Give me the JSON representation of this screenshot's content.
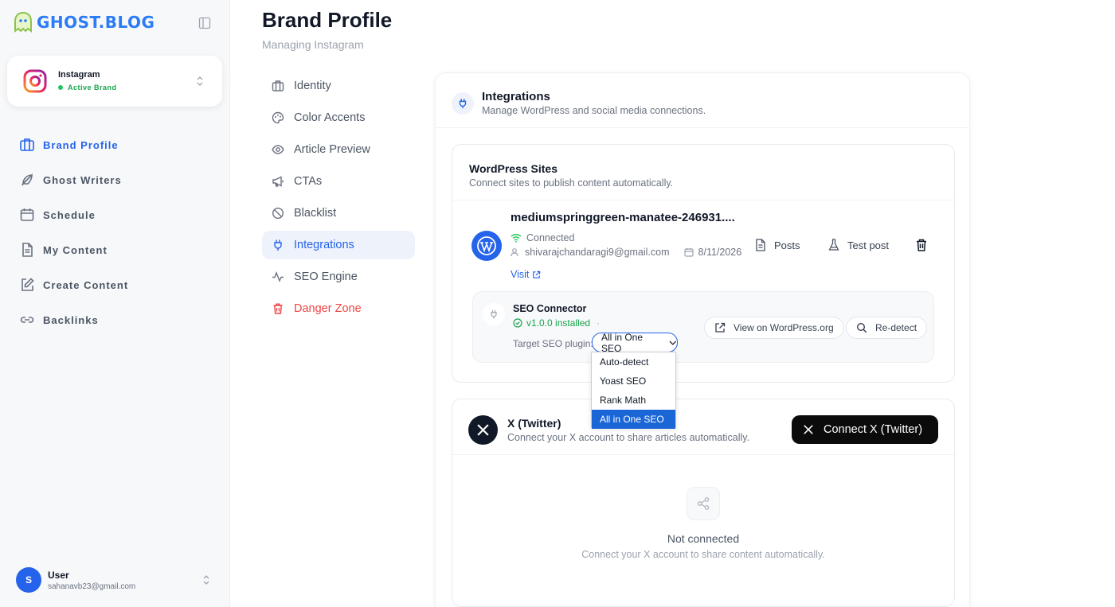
{
  "app": {
    "logo": "GHOST.BLOG"
  },
  "brand": {
    "name": "Instagram",
    "status": "Active Brand"
  },
  "sidebar": {
    "items": [
      {
        "label": "Brand Profile",
        "icon": "briefcase-icon",
        "active": true
      },
      {
        "label": "Ghost Writers",
        "icon": "feather-icon"
      },
      {
        "label": "Schedule",
        "icon": "calendar-icon"
      },
      {
        "label": "My Content",
        "icon": "file-text-icon"
      },
      {
        "label": "Create Content",
        "icon": "edit-icon"
      },
      {
        "label": "Backlinks",
        "icon": "link-icon"
      }
    ]
  },
  "user": {
    "initial": "S",
    "name": "User",
    "email": "sahanavb23@gmail.com"
  },
  "header": {
    "title": "Brand Profile",
    "subtitle": "Managing Instagram"
  },
  "subnav": {
    "items": [
      {
        "label": "Identity"
      },
      {
        "label": "Color Accents"
      },
      {
        "label": "Article Preview"
      },
      {
        "label": "CTAs"
      },
      {
        "label": "Blacklist"
      },
      {
        "label": "Integrations",
        "active": true
      },
      {
        "label": "SEO Engine"
      },
      {
        "label": "Danger Zone",
        "danger": true
      }
    ]
  },
  "integrations": {
    "title": "Integrations",
    "subtitle": "Manage WordPress and social media connections."
  },
  "wordpress": {
    "title": "WordPress Sites",
    "subtitle": "Connect sites to publish content automatically.",
    "site": {
      "name": "mediumspringgreen-manatee-246931....",
      "status": "Connected",
      "email": "shivarajchandaragi9@gmail.com",
      "date": "8/11/2026",
      "visit": "Visit",
      "posts": "Posts",
      "test_post": "Test post"
    },
    "seo": {
      "title": "SEO Connector",
      "version": "v1.0.0 installed",
      "version_sep": "·",
      "target_label": "Target SEO plugin:",
      "selected": "All in One SEO",
      "options": [
        "Auto-detect",
        "Yoast SEO",
        "Rank Math",
        "All in One SEO"
      ],
      "view_wp": "View on WordPress.org",
      "redetect": "Re-detect"
    }
  },
  "twitter": {
    "title": "X (Twitter)",
    "subtitle": "Connect your X account to share articles automatically.",
    "button": "Connect X (Twitter)",
    "empty_title": "Not connected",
    "empty_sub": "Connect your X account to share content automatically."
  },
  "colors": {
    "accent": "#2563eb",
    "success": "#16a34a",
    "danger": "#ef4444"
  }
}
